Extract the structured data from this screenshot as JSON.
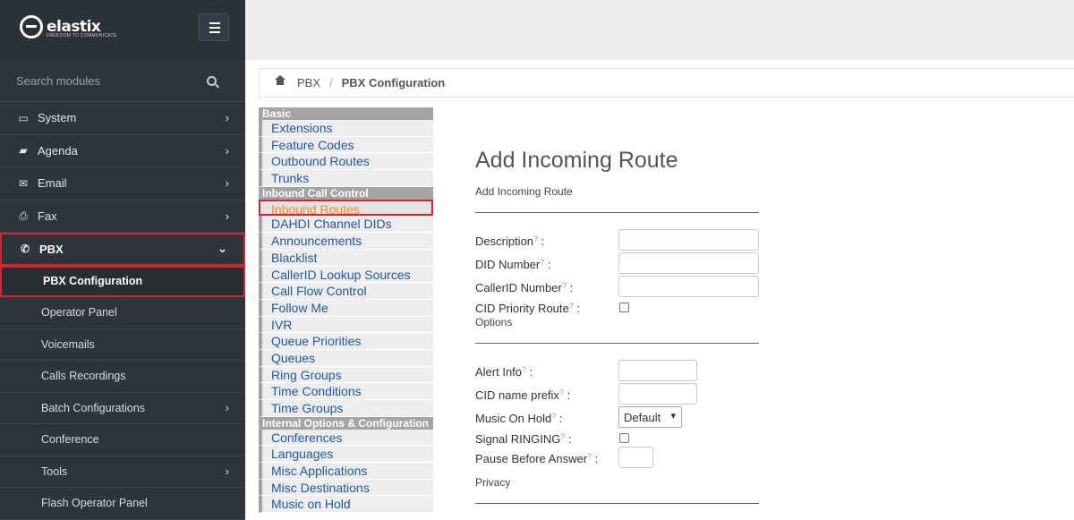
{
  "brand": {
    "name": "elastix",
    "tagline": "FREEDOM TO COMMUNICATE"
  },
  "search": {
    "placeholder": "Search modules"
  },
  "nav": [
    {
      "label": "System",
      "icon": "laptop-icon"
    },
    {
      "label": "Agenda",
      "icon": "book-icon"
    },
    {
      "label": "Email",
      "icon": "envelope-icon"
    },
    {
      "label": "Fax",
      "icon": "printer-icon"
    },
    {
      "label": "PBX",
      "icon": "phone-icon"
    }
  ],
  "pbx_sub": [
    {
      "label": "PBX Configuration"
    },
    {
      "label": "Operator Panel"
    },
    {
      "label": "Voicemails"
    },
    {
      "label": "Calls Recordings"
    },
    {
      "label": "Batch Configurations"
    },
    {
      "label": "Conference"
    },
    {
      "label": "Tools"
    },
    {
      "label": "Flash Operator Panel"
    }
  ],
  "breadcrumb": {
    "first": "PBX",
    "separator": "/",
    "current": "PBX Configuration"
  },
  "pbx_menu": {
    "basic": "Basic",
    "basic_items": [
      "Extensions",
      "Feature Codes",
      "Outbound Routes",
      "Trunks"
    ],
    "inbound": "Inbound Call Control",
    "inbound_items": [
      "Inbound Routes",
      "DAHDI Channel DIDs",
      "Announcements",
      "Blacklist",
      "CallerID Lookup Sources",
      "Call Flow Control",
      "Follow Me",
      "IVR",
      "Queue Priorities",
      "Queues",
      "Ring Groups",
      "Time Conditions",
      "Time Groups"
    ],
    "internal": "Internal Options & Configuration",
    "internal_items": [
      "Conferences",
      "Languages",
      "Misc Applications",
      "Misc Destinations",
      "Music on Hold"
    ]
  },
  "form": {
    "title": "Add Incoming Route",
    "subtitle": "Add Incoming Route",
    "description": "Description",
    "did_number": "DID Number",
    "callerid_number": "CallerID Number",
    "cid_priority": "CID Priority Route",
    "options": "Options",
    "alert_info": "Alert Info",
    "cid_prefix": "CID name prefix",
    "moh": "Music On Hold",
    "moh_value": "Default",
    "signal_ringing": "Signal RINGING",
    "pause": "Pause Before Answer",
    "privacy": "Privacy",
    "help": "?",
    "colon": ":"
  }
}
